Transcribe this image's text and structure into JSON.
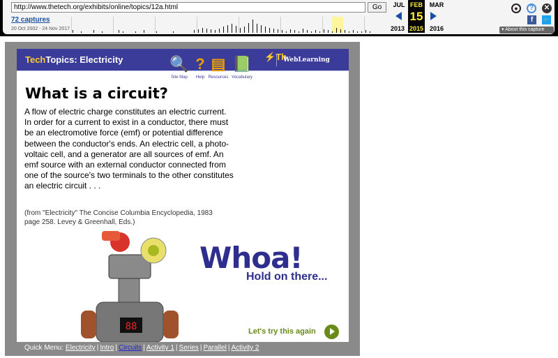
{
  "toolbar": {
    "url": "http://www.thetech.org/exhibits/online/topics/12a.html",
    "go_label": "Go",
    "captures_label": "72 captures",
    "date_range": "20 Oct 2002 - 24 Nov 2017",
    "prev_month": "JUL",
    "current_month": "FEB",
    "next_month": "MAR",
    "current_day": "15",
    "prev_year": "2013",
    "current_year": "2015",
    "next_year": "2016",
    "about_label": "About this capture"
  },
  "banner": {
    "title_prefix": "Tech",
    "title_suffix": "Topics: Electricity",
    "partial_logo_text": "Th",
    "tagline": "WebLearning",
    "nav_items": [
      {
        "label": "Site Map",
        "icon": "site-map-icon"
      },
      {
        "label": "Help",
        "icon": "help-question-icon"
      },
      {
        "label": "Resources",
        "icon": "books-icon"
      },
      {
        "label": "Vocabulary",
        "icon": "abc-book-icon"
      }
    ]
  },
  "article": {
    "title": "What is a circuit?",
    "body": "A flow of electric charge constitutes an electric current. In order for a current to exist in a conductor, there must be an electromotive force (emf) or potential difference between the conductor's ends. An electric cell, a photo-voltaic cell, and a generator are all sources of emf. An emf source with an external conductor connected from one of the source's two terminals to the other constitutes an electric circuit . . .",
    "citation": "(from \"Electricity\" The Concise Columbia Encyclopedia, 1983 page 258. Levey & Greenhall, Eds.)"
  },
  "robot_panel": {
    "whoa": "Whoa!",
    "hold": "Hold on there...",
    "retry": "Let's try this again",
    "display": "88"
  },
  "quick_menu": {
    "label": "Quick Menu:",
    "items": [
      "Electricity",
      "Intro",
      "Circuits",
      "Activity 1",
      "Series",
      "Parallel",
      "Activity 2"
    ]
  },
  "colors": {
    "banner": "#3b3b9a",
    "accent": "#ffcc33",
    "whoa": "#2e2e8f",
    "retry": "#6a8a1a"
  }
}
